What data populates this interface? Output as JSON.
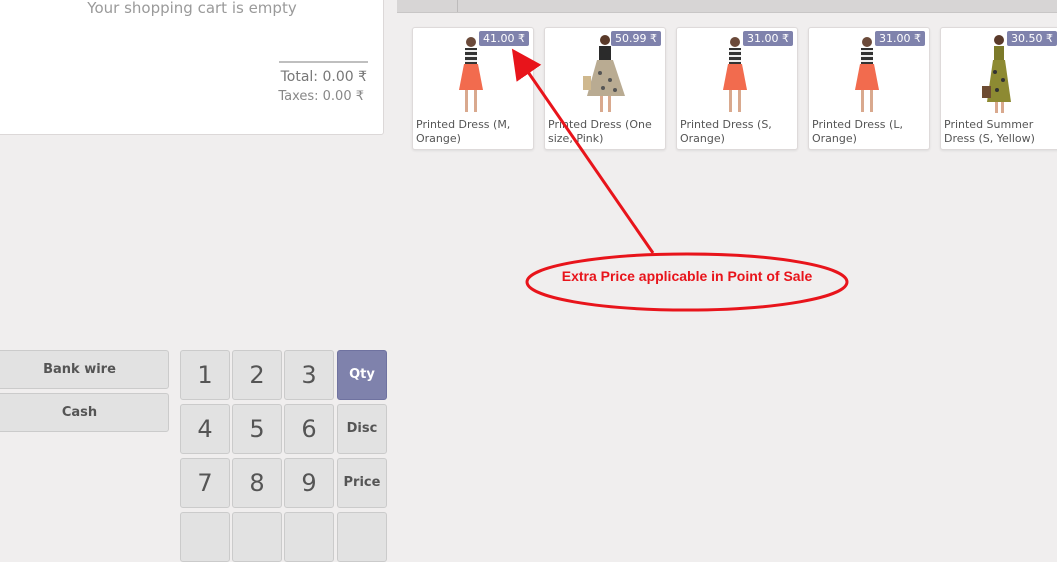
{
  "cart": {
    "empty_text": "Your shopping cart is empty",
    "total": "Total: 0.00 ₹",
    "taxes": "Taxes: 0.00 ₹"
  },
  "products": [
    {
      "name": "Printed Dress (M, Orange)",
      "price": "41.00 ₹"
    },
    {
      "name": "Printed Dress (One size, Pink)",
      "price": "50.99 ₹"
    },
    {
      "name": "Printed Dress (S, Orange)",
      "price": "31.00 ₹"
    },
    {
      "name": "Printed Dress (L, Orange)",
      "price": "31.00 ₹"
    },
    {
      "name": "Printed Summer Dress (S, Yellow)",
      "price": "30.50 ₹"
    }
  ],
  "payment_methods": [
    "Bank wire",
    "Cash"
  ],
  "numpad": {
    "keys": [
      "1",
      "2",
      "3",
      "4",
      "5",
      "6",
      "7",
      "8",
      "9"
    ],
    "modes": [
      "Qty",
      "Disc",
      "Price"
    ],
    "active_mode": "Qty"
  },
  "annotation": {
    "text": "Extra Price applicable in Point of Sale",
    "color": "#e8141b"
  },
  "colors": {
    "accent": "#7f82ac",
    "background": "#f0eeee"
  }
}
